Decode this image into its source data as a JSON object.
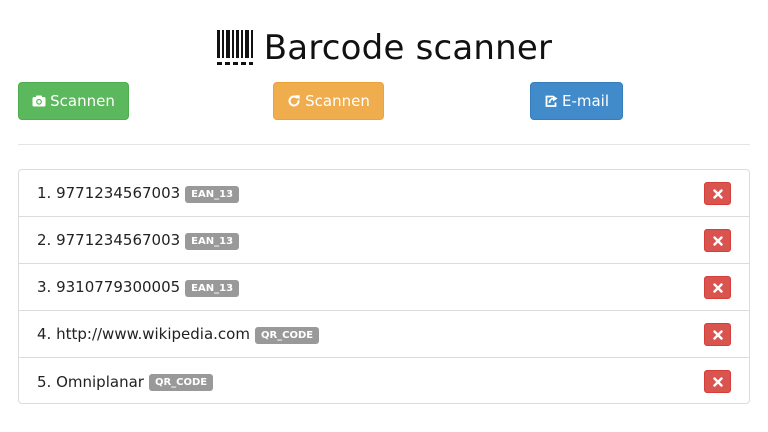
{
  "app": {
    "title": "Barcode scanner"
  },
  "toolbar": {
    "scan_camera_label": "Scannen",
    "scan_refresh_label": "Scannen",
    "email_label": "E-mail"
  },
  "scans": [
    {
      "index": "1.",
      "value": "9771234567003",
      "format": "EAN_13"
    },
    {
      "index": "2.",
      "value": "9771234567003",
      "format": "EAN_13"
    },
    {
      "index": "3.",
      "value": "9310779300005",
      "format": "EAN_13"
    },
    {
      "index": "4.",
      "value": "http://www.wikipedia.com",
      "format": "QR_CODE"
    },
    {
      "index": "5.",
      "value": "Omniplanar",
      "format": "QR_CODE"
    }
  ],
  "colors": {
    "green": "#5cb85c",
    "orange": "#f0ad4e",
    "blue": "#428bca",
    "danger": "#d9534f",
    "badge": "#999999"
  },
  "icons": {
    "header": "barcode-icon",
    "btn1": "camera-icon",
    "btn2": "refresh-icon",
    "btn3": "share-icon",
    "delete": "close-icon"
  }
}
